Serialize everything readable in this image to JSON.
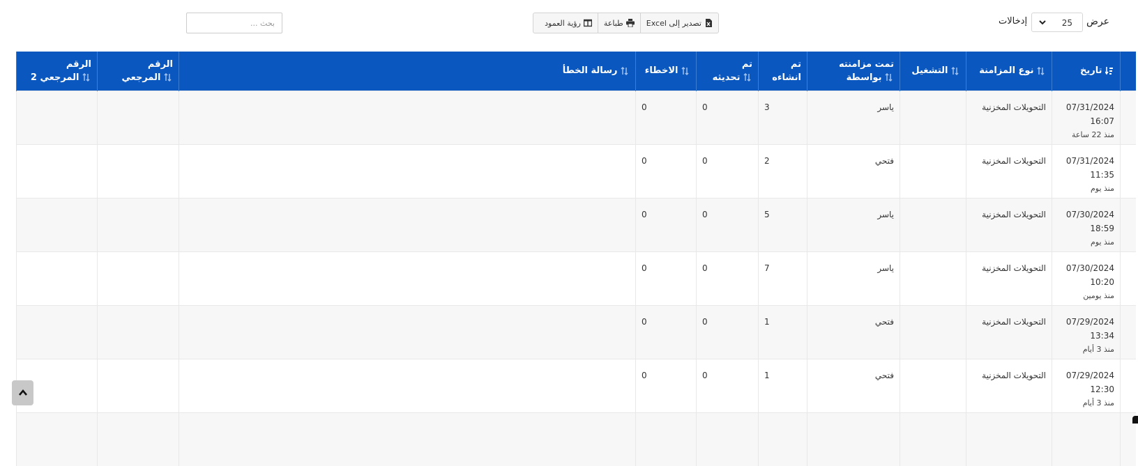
{
  "controls": {
    "show_label": "عرض",
    "entries_value": "25",
    "entries_label": "إدخالات",
    "buttons": [
      {
        "label": "تصدير إلى Excel",
        "icon": "excel-file-icon"
      },
      {
        "label": "طباعة",
        "icon": "printer-icon"
      },
      {
        "label": "رؤية العمود",
        "icon": "columns-icon"
      }
    ],
    "search_placeholder": "بحث ..."
  },
  "table": {
    "columns": [
      {
        "line1": "تاريخ",
        "line2": ""
      },
      {
        "line1": "نوع المزامنة",
        "line2": ""
      },
      {
        "line1": "التشغيل",
        "line2": ""
      },
      {
        "line1": "تمت مزامنته",
        "line2": "بواسطة"
      },
      {
        "line1": "تم",
        "line2": "انشاءه"
      },
      {
        "line1": "تم",
        "line2": "تحديثه"
      },
      {
        "line1": "الاخطاء",
        "line2": ""
      },
      {
        "line1": "رسالة الخطأ",
        "line2": ""
      },
      {
        "line1": "الرقم",
        "line2": "المرجعي"
      },
      {
        "line1": "الرقم",
        "line2": "المرجعي 2"
      }
    ],
    "rows": [
      {
        "date": "07/31/2024",
        "time": "16:07",
        "ago": "منذ 22 ساعة",
        "sync_type": "التحويلات المخزنية",
        "run": "",
        "synced_by": "ياسر",
        "created": "3",
        "updated": "0",
        "errors": "0",
        "error_msg": "",
        "ref": "",
        "ref2": ""
      },
      {
        "date": "07/31/2024",
        "time": "11:35",
        "ago": "منذ يوم",
        "sync_type": "التحويلات المخزنية",
        "run": "",
        "synced_by": "فتحي",
        "created": "2",
        "updated": "0",
        "errors": "0",
        "error_msg": "",
        "ref": "",
        "ref2": ""
      },
      {
        "date": "07/30/2024",
        "time": "18:59",
        "ago": "منذ يوم",
        "sync_type": "التحويلات المخزنية",
        "run": "",
        "synced_by": "ياسر",
        "created": "5",
        "updated": "0",
        "errors": "0",
        "error_msg": "",
        "ref": "",
        "ref2": ""
      },
      {
        "date": "07/30/2024",
        "time": "10:20",
        "ago": "منذ يومين",
        "sync_type": "التحويلات المخزنية",
        "run": "",
        "synced_by": "ياسر",
        "created": "7",
        "updated": "0",
        "errors": "0",
        "error_msg": "",
        "ref": "",
        "ref2": ""
      },
      {
        "date": "07/29/2024",
        "time": "13:34",
        "ago": "منذ 3 أيام",
        "sync_type": "التحويلات المخزنية",
        "run": "",
        "synced_by": "فتحي",
        "created": "1",
        "updated": "0",
        "errors": "0",
        "error_msg": "",
        "ref": "",
        "ref2": ""
      },
      {
        "date": "07/29/2024",
        "time": "12:30",
        "ago": "منذ 3 أيام",
        "sync_type": "التحويلات المخزنية",
        "run": "",
        "synced_by": "فتحي",
        "created": "1",
        "updated": "0",
        "errors": "0",
        "error_msg": "",
        "ref": "",
        "ref2": ""
      }
    ]
  },
  "colors": {
    "header_bg": "#0a58bf",
    "header_text": "#ffffff",
    "row_alt": "#f7f7f7"
  }
}
